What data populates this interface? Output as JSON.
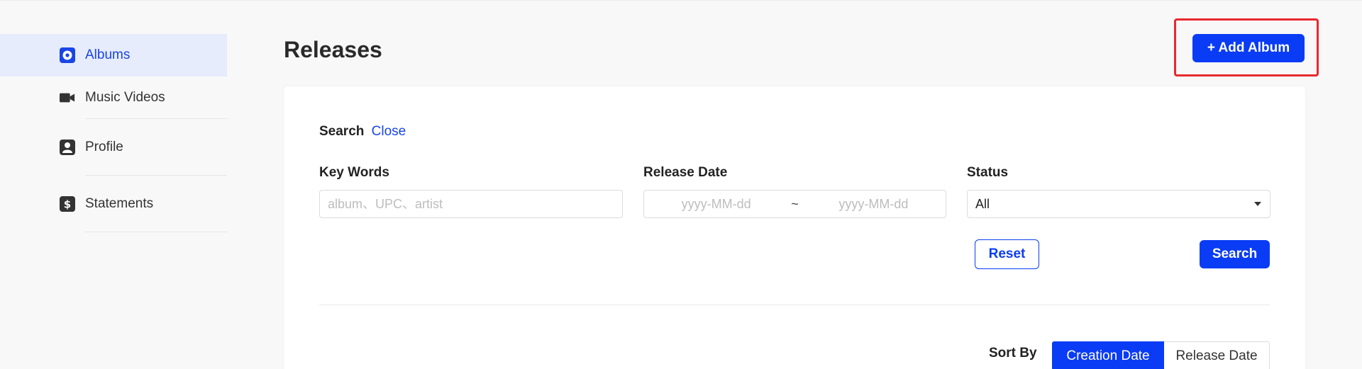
{
  "sidebar": {
    "items": [
      {
        "label": "Albums",
        "icon": "disc-icon",
        "active": true
      },
      {
        "label": "Music Videos",
        "icon": "video-camera-icon"
      },
      {
        "label": "Profile",
        "icon": "profile-icon"
      },
      {
        "label": "Statements",
        "icon": "dollar-icon"
      }
    ]
  },
  "header": {
    "title": "Releases",
    "add_button": "+ Add Album"
  },
  "search": {
    "heading": "Search",
    "close_label": "Close",
    "keywords": {
      "label": "Key Words",
      "placeholder": "album、UPC、artist",
      "value": ""
    },
    "release_date": {
      "label": "Release Date",
      "start_placeholder": "yyyy-MM-dd",
      "end_placeholder": "yyyy-MM-dd",
      "separator": "~"
    },
    "status": {
      "label": "Status",
      "value": "All"
    },
    "reset_label": "Reset",
    "search_label": "Search"
  },
  "sort": {
    "label": "Sort By",
    "options": [
      "Creation Date",
      "Release Date"
    ],
    "selected": "Creation Date"
  },
  "colors": {
    "accent": "#0a3cf5",
    "active_bg": "#e6ecfb",
    "highlight_border": "#e8292e"
  }
}
